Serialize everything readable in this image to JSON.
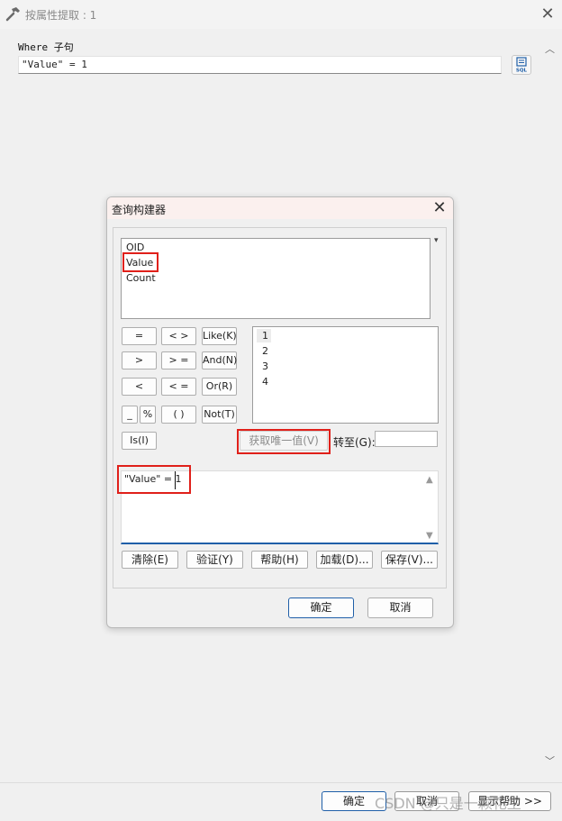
{
  "outer": {
    "title": "按属性提取 : 1",
    "where_label": "Where 子句",
    "where_value": "\"Value\" =  1",
    "sql_button": "SQL",
    "ok": "确定",
    "cancel": "取消",
    "help": "显示帮助 >>",
    "watermark": "CSDN @只是一颗花生"
  },
  "dialog": {
    "title": "查询构建器",
    "fields": [
      "OID",
      "Value",
      "Count"
    ],
    "operators": {
      "eq": "=",
      "ne": "< >",
      "like": "Like(K)",
      "gt": ">",
      "ge": "> =",
      "and": "And(N)",
      "lt": "<",
      "le": "< =",
      "or": "Or(R)",
      "underscore": "_",
      "percent": "%",
      "parens": "( )",
      "not": "Not(T)",
      "is": "Is(I)"
    },
    "values": [
      "1",
      "2",
      "3",
      "4"
    ],
    "unique_button": "获取唯一值(V)",
    "goto_label": "转至(G):",
    "goto_value": "",
    "expression": "\"Value\" = 1",
    "bottom_buttons": {
      "clear": "清除(E)",
      "verify": "验证(Y)",
      "help": "帮助(H)",
      "load": "加载(D)...",
      "save": "保存(V)..."
    },
    "ok": "确定",
    "cancel": "取消"
  },
  "colors": {
    "highlight_box": "#e0201a",
    "accent": "#1f5fa8"
  }
}
